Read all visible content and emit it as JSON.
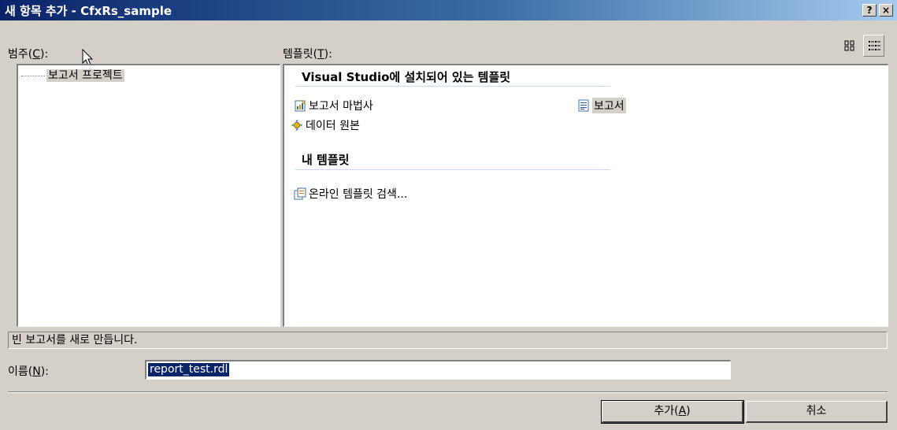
{
  "window": {
    "title": "새 항목 추가 - CfxRs_sample",
    "help_glyph": "?",
    "close_glyph": "×"
  },
  "categories": {
    "label_prefix": "범주(",
    "label_key": "C",
    "label_suffix": "):",
    "items": [
      {
        "label": "보고서 프로젝트"
      }
    ]
  },
  "templates": {
    "label_prefix": "템플릿(",
    "label_key": "T",
    "label_suffix": "):",
    "groups": [
      {
        "title": "Visual Studio에 설치되어 있는 템플릿"
      },
      {
        "title": "내 템플릿"
      }
    ],
    "items": [
      {
        "label": "보고서 마법사",
        "icon": "report-wizard-icon"
      },
      {
        "label": "보고서",
        "icon": "report-icon"
      },
      {
        "label": "데이터 원본",
        "icon": "data-source-icon"
      },
      {
        "label": "온라인 템플릿 검색...",
        "icon": "online-template-icon"
      }
    ]
  },
  "description": "빈 보고서를 새로 만듭니다.",
  "name_field": {
    "label_prefix": "이름(",
    "label_key": "N",
    "label_suffix": "):",
    "value": "report_test.rdl"
  },
  "buttons": {
    "add_prefix": "추가(",
    "add_key": "A",
    "add_suffix": ")",
    "cancel": "취소"
  },
  "colors": {
    "title_bar_start": "#0a246a",
    "title_bar_end": "#a6caf0",
    "dialog_bg": "#d4d0c8",
    "selection": "#0a246a"
  }
}
